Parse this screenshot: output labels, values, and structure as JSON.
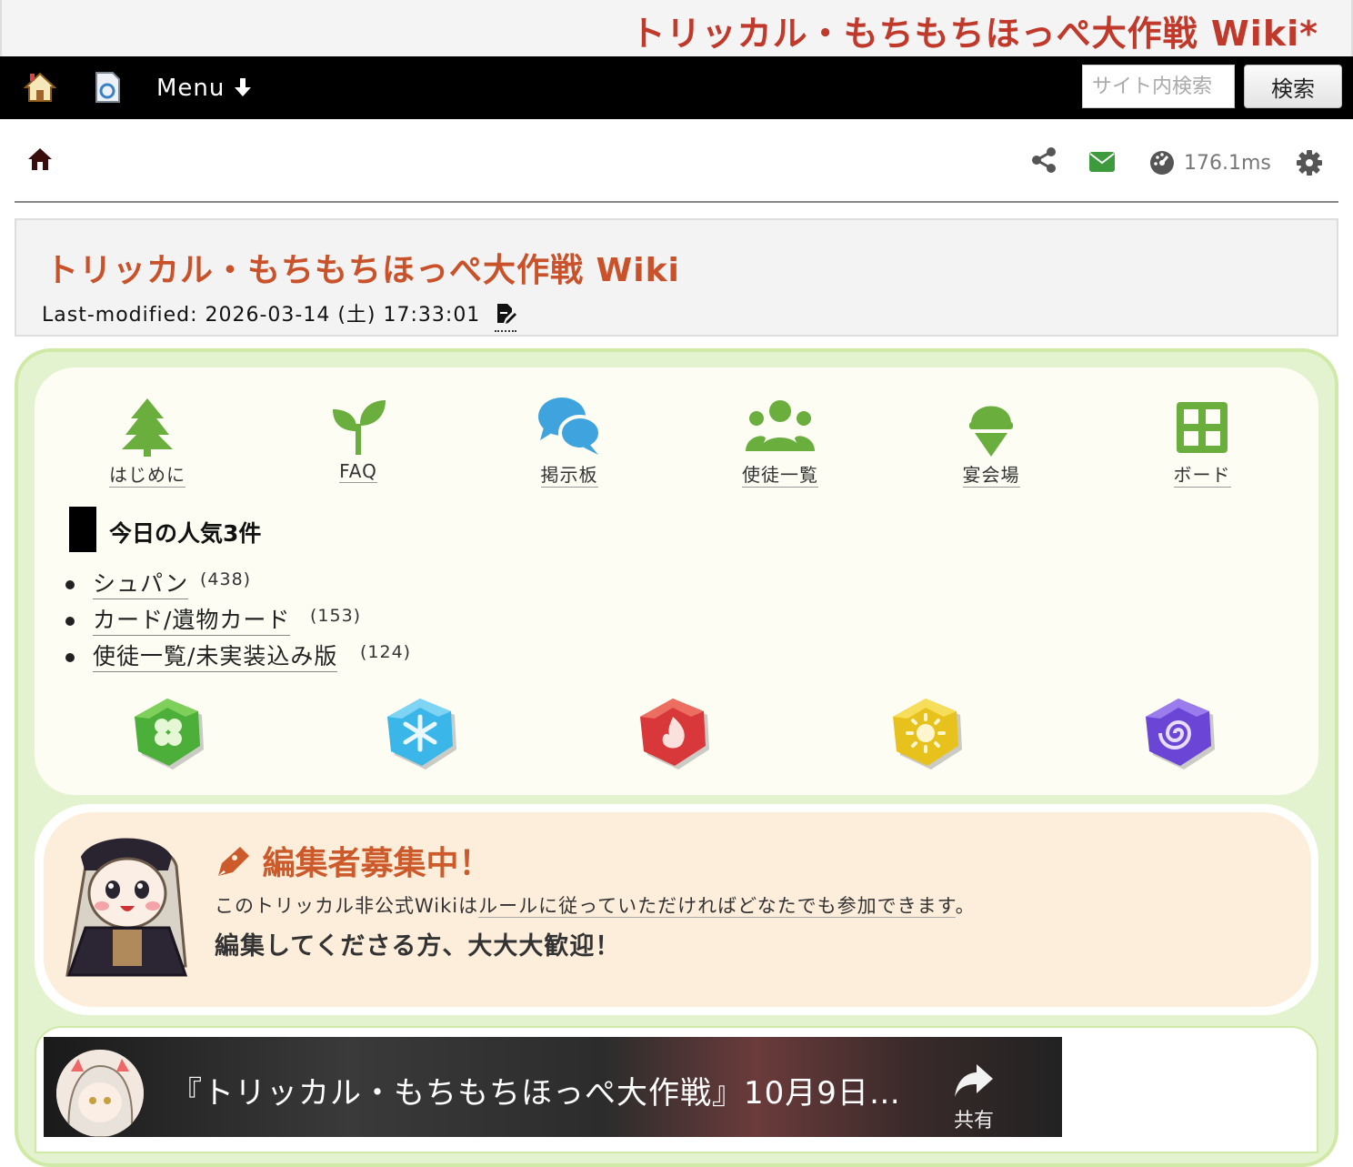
{
  "site": {
    "title": "トリッカル・もちもちほっぺ大作戦 Wiki*"
  },
  "navbar": {
    "menu_label": "Menu",
    "search_placeholder": "サイト内検索",
    "search_button": "検索"
  },
  "toolbar": {
    "perf": "176.1ms"
  },
  "page": {
    "title": "トリッカル・もちもちほっぺ大作戦 Wiki",
    "last_modified": "Last-modified: 2026-03-14 (土) 17:33:01"
  },
  "nav_tiles": [
    {
      "label": "はじめに",
      "icon": "tree-icon",
      "color": "#6aae3e"
    },
    {
      "label": "FAQ",
      "icon": "sprout-icon",
      "color": "#6aae3e"
    },
    {
      "label": "掲示板",
      "icon": "chat-bubbles-icon",
      "color": "#3fa4dd"
    },
    {
      "label": "使徒一覧",
      "icon": "users-icon",
      "color": "#6aae3e"
    },
    {
      "label": "宴会場",
      "icon": "ice-cream-icon",
      "color": "#6aae3e"
    },
    {
      "label": "ボード",
      "icon": "grid-icon",
      "color": "#6aae3e"
    }
  ],
  "popular": {
    "heading": "今日の人気3件",
    "items": [
      {
        "label": "シュパン",
        "count": "(438)"
      },
      {
        "label": "カード/遺物カード",
        "count": "(153)"
      },
      {
        "label": "使徒一覧/未実装込み版",
        "count": "(124)"
      }
    ]
  },
  "gems": [
    {
      "icon": "clover-gem-icon",
      "color": "#4caf3a"
    },
    {
      "icon": "snowflake-gem-icon",
      "color": "#3ab6e8"
    },
    {
      "icon": "flame-gem-icon",
      "color": "#d8383a"
    },
    {
      "icon": "sun-gem-icon",
      "color": "#e8c21c"
    },
    {
      "icon": "spiral-gem-icon",
      "color": "#6a45d6"
    }
  ],
  "recruit": {
    "title": "編集者募集中！",
    "line1_a": "このトリッカル非公式Wikiは",
    "line1_link": "ルールに従っていただければどなたでも参加できます",
    "line1_b": "。",
    "line2": "編集してくださる方、大大大歓迎！"
  },
  "video": {
    "title": "『トリッカル・もちもちほっぺ大作戦』10月9日…",
    "share_label": "共有"
  },
  "colors": {
    "accent": "#c9522a",
    "green_frame": "#cfe9a6",
    "cream": "#fdfdf3"
  }
}
